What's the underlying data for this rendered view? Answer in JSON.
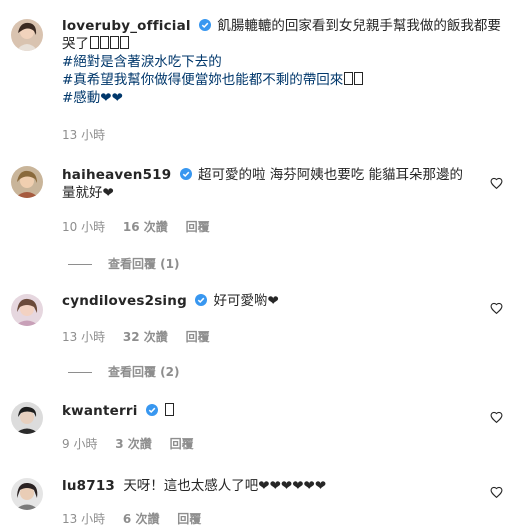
{
  "comments": [
    {
      "username": "loveruby_official",
      "verified": true,
      "lines": [
        "飢腸轆轆的回家看到女兒親手幫我做的飯我都要",
        "哭了"
      ],
      "hashtags": [
        "#絕對是含著淚水吃下去的",
        "#真希望我幫你做得便當妳也能都不剩的帶回來",
        "#感動❤❤"
      ],
      "time": "13 小時"
    },
    {
      "username": "haiheaven519",
      "verified": true,
      "lines": [
        "超可愛的啦 海芬阿姨也要吃 能貓耳朵那邊的",
        "量就好❤"
      ],
      "time": "10 小時",
      "likes": "16 次讚",
      "reply": "回覆",
      "view_replies": "查看回覆 (1)"
    },
    {
      "username": "cyndiloves2sing",
      "verified": true,
      "lines": [
        "好可愛喲❤"
      ],
      "time": "13 小時",
      "likes": "32 次讚",
      "reply": "回覆",
      "view_replies": "查看回覆 (2)"
    },
    {
      "username": "kwanterri",
      "verified": true,
      "lines": [
        ""
      ],
      "time": "9 小時",
      "likes": "3 次讚",
      "reply": "回覆"
    },
    {
      "username": "lu8713",
      "verified": false,
      "lines": [
        "天呀！這也太感人了吧❤❤❤❤❤❤"
      ],
      "time": "13 小時",
      "likes": "6 次讚",
      "reply": "回覆"
    }
  ],
  "colors": {
    "verified": "#3897f0",
    "meta": "#8e8e8e",
    "hashtag": "#00376b"
  }
}
